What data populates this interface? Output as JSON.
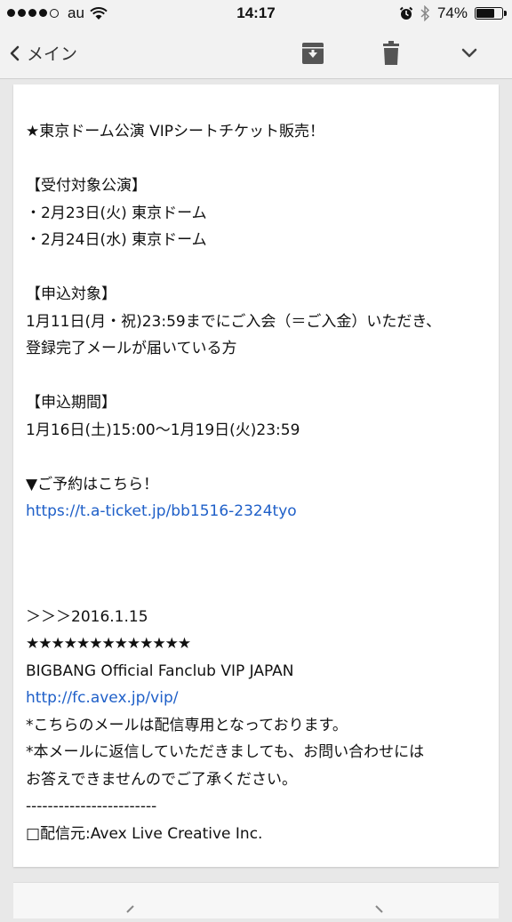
{
  "status_bar": {
    "carrier": "au",
    "time": "14:17",
    "battery": "74%",
    "battery_level": 0.74
  },
  "toolbar": {
    "back_label": "メイン",
    "icons": [
      "archive-icon",
      "trash-icon",
      "chevron-down-icon"
    ]
  },
  "email": {
    "heading": "★東京ドーム公演 VIPシートチケット販売！",
    "section1_title": "【受付対象公演】",
    "section1_line1": "・2月23日(火) 東京ドーム",
    "section1_line2": "・2月24日(水) 東京ドーム",
    "section2_title": "【申込対象】",
    "section2_line1": "1月11日(月・祝)23:59までにご入会（＝ご入金）いただき、",
    "section2_line2": "登録完了メールが届いている方",
    "section3_title": "【申込期間】",
    "section3_line1": "1月16日(土)15:00〜1月19日(火)23:59",
    "reserve_label": "▼ご予約はこちら！",
    "reserve_link": "https://t.a-ticket.jp/bb1516-2324tyo",
    "date_line": "＞＞＞2016.1.15",
    "stars_line": "★★★★★★★★★★★★★",
    "club_name": "BIGBANG Official Fanclub VIP JAPAN",
    "club_link": "http://fc.avex.jp/vip/",
    "notice1": "*こちらのメールは配信専用となっております。",
    "notice2": "*本メールに返信していただきましても、お問い合わせには",
    "notice3": "お答えできませんのでご了承ください。",
    "divider": "------------------------",
    "sender": "□配信元:Avex Live Creative Inc."
  }
}
